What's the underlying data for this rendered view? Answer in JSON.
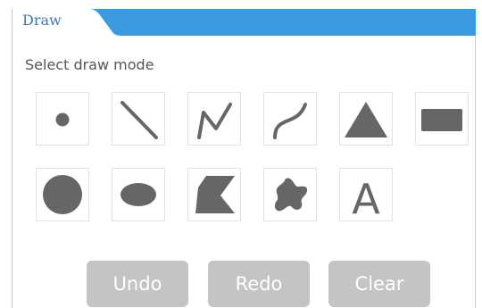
{
  "tab": {
    "title": "Draw"
  },
  "mode_label": "Select draw mode",
  "tools": [
    {
      "icon": "point-icon"
    },
    {
      "icon": "line-icon"
    },
    {
      "icon": "polyline-icon"
    },
    {
      "icon": "curve-icon"
    },
    {
      "icon": "triangle-icon"
    },
    {
      "icon": "rectangle-icon"
    },
    {
      "icon": "circle-icon"
    },
    {
      "icon": "ellipse-icon"
    },
    {
      "icon": "polygon-icon"
    },
    {
      "icon": "freehand-icon"
    },
    {
      "icon": "text-icon",
      "glyph": "A"
    }
  ],
  "buttons": {
    "undo": "Undo",
    "redo": "Redo",
    "clear": "Clear"
  },
  "colors": {
    "tab_blue": "#3a9ae0",
    "icon_gray": "#666666",
    "disabled_button": "#c4c4c4"
  }
}
